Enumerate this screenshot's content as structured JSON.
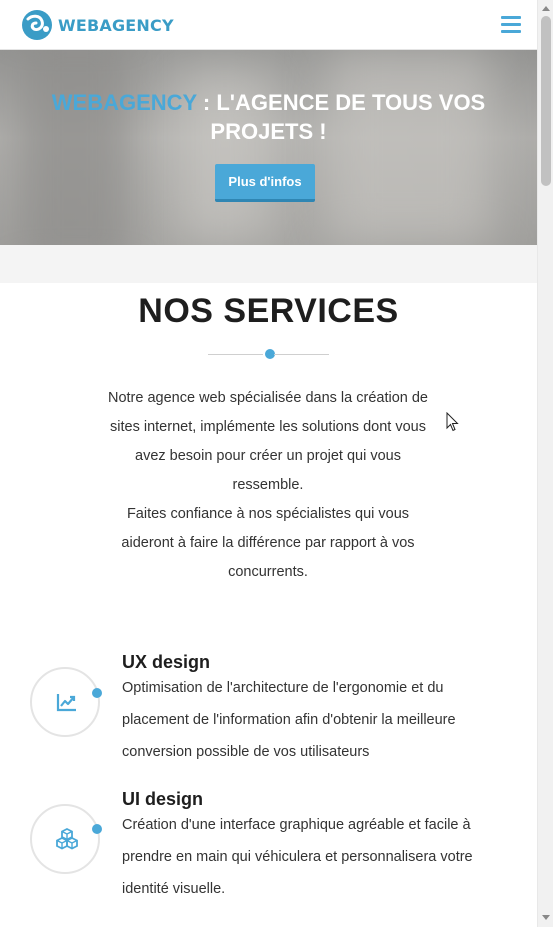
{
  "header": {
    "logo_text": "WEBAGENCY",
    "menu_icon": "hamburger-menu-icon"
  },
  "hero": {
    "title_brand": "WEBAGENCY",
    "title_rest_line1": " : L'AGENCE DE TOUS VOS",
    "title_line2": "PROJETS !",
    "button_label": "Plus d'infos"
  },
  "services": {
    "title": "NOS SERVICES",
    "intro_p1": "Notre agence web spécialisée dans la création de sites internet, implémente les solutions dont vous avez besoin pour créer un projet qui vous ressemble.",
    "intro_p2": "Faites confiance à nos spécialistes qui vous aideront à faire la différence par rapport à vos concurrents.",
    "items": [
      {
        "icon": "chart-trend-icon",
        "title": "UX design",
        "description": "Optimisation de l'architecture de l'ergonomie et du placement de l'information afin d'obtenir la meilleure conversion possible de vos utilisateurs"
      },
      {
        "icon": "cubes-icon",
        "title": "UI design",
        "description": "Création d'une interface graphique agréable et facile à prendre en main qui véhiculera et personnalisera votre identité visuelle."
      }
    ]
  },
  "colors": {
    "accent": "#4aa8d8",
    "title": "#1e1e1e",
    "text": "#333333",
    "band": "#f4f4f4"
  }
}
